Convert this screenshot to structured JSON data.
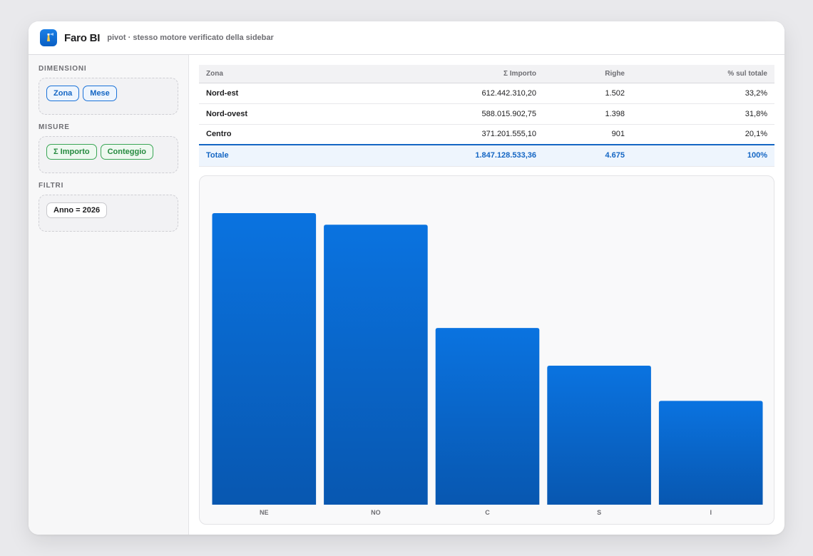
{
  "app": {
    "name": "Faro BI",
    "subtitle": "pivot · stesso motore verificato della sidebar",
    "icon": "lighthouse-icon",
    "accent": "#0a6fd6"
  },
  "sidebar": {
    "sections": [
      {
        "title": "DIMENSIONI",
        "kind": "dim",
        "chips": [
          "Zona",
          "Mese"
        ]
      },
      {
        "title": "MISURE",
        "kind": "mea",
        "chips": [
          "Σ Importo",
          "Conteggio"
        ]
      },
      {
        "title": "FILTRI",
        "kind": "fil",
        "chips": [
          "Anno = 2026"
        ]
      }
    ]
  },
  "table": {
    "headers": [
      "Zona",
      "Σ Importo",
      "Righe",
      "% sul totale"
    ],
    "rows": [
      [
        "Nord-est",
        "612.442.310,20",
        "1.502",
        "33,2%"
      ],
      [
        "Nord-ovest",
        "588.015.902,75",
        "1.398",
        "31,8%"
      ],
      [
        "Centro",
        "371.201.555,10",
        "901",
        "20,1%"
      ]
    ],
    "total": [
      "Totale",
      "1.847.128.533,36",
      "4.675",
      "100%"
    ]
  },
  "chart_data": {
    "type": "bar",
    "categories": [
      "NE",
      "NO",
      "C",
      "S",
      "I"
    ],
    "values": [
      612.44,
      588.02,
      371.2,
      292,
      218
    ],
    "title": "",
    "xlabel": "",
    "ylabel": "",
    "ylim": [
      0,
      612.44
    ],
    "grid": false,
    "bar_color_top": "#0a73e0",
    "bar_color_bottom": "#0857b0"
  }
}
